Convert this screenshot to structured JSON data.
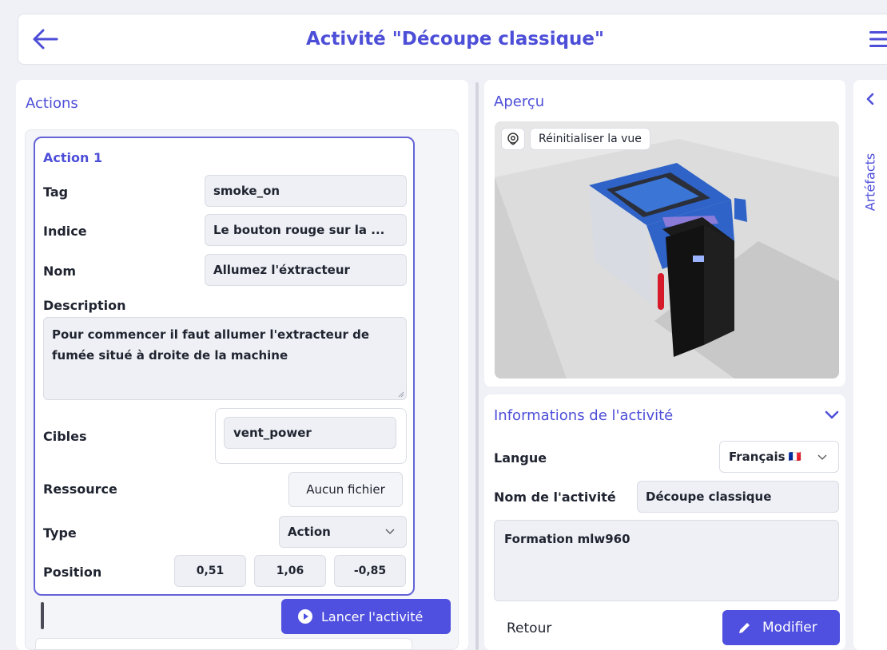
{
  "header": {
    "title": "Activité \"Découpe classique\"",
    "back_icon": "arrow-left-icon",
    "menu_icon": "hamburger-menu-icon"
  },
  "actions_panel": {
    "title": "Actions",
    "action": {
      "title": "Action 1",
      "tag_label": "Tag",
      "tag_value": "smoke_on",
      "hint_label": "Indice",
      "hint_value": "Le  bouton rouge sur la  ...",
      "name_label": "Nom",
      "name_value": "Allumez l'éxtracteur",
      "description_label": "Description",
      "description_value": "Pour commencer il faut allumer l'extracteur de fumée situé à droite de la machine",
      "targets_label": "Cibles",
      "targets": [
        "vent_power"
      ],
      "resource_label": "Ressource",
      "resource_button": "Aucun fichier",
      "type_label": "Type",
      "type_value": "Action",
      "position_label": "Position",
      "position": [
        "0,51",
        "1,06",
        "-0,85"
      ]
    },
    "launch_button": "Lancer l'activité"
  },
  "preview_panel": {
    "title": "Aperçu",
    "reset_view": "Réinitialiser la vue",
    "location_icon": "location-pin-icon"
  },
  "info_panel": {
    "title": "Informations de l'activité",
    "language_label": "Langue",
    "language_value": "Français",
    "language_flag": "🇫🇷",
    "activity_name_label": "Nom de l'activité",
    "activity_name_value": "Découpe classique",
    "description_value": "Formation mlw960",
    "back_button": "Retour",
    "modify_button": "Modifier"
  },
  "artifacts_tab": {
    "label": "Artéfacts"
  },
  "colors": {
    "accent": "#4d4ed8",
    "button": "#4f4fe0",
    "background": "#eff1f6"
  }
}
